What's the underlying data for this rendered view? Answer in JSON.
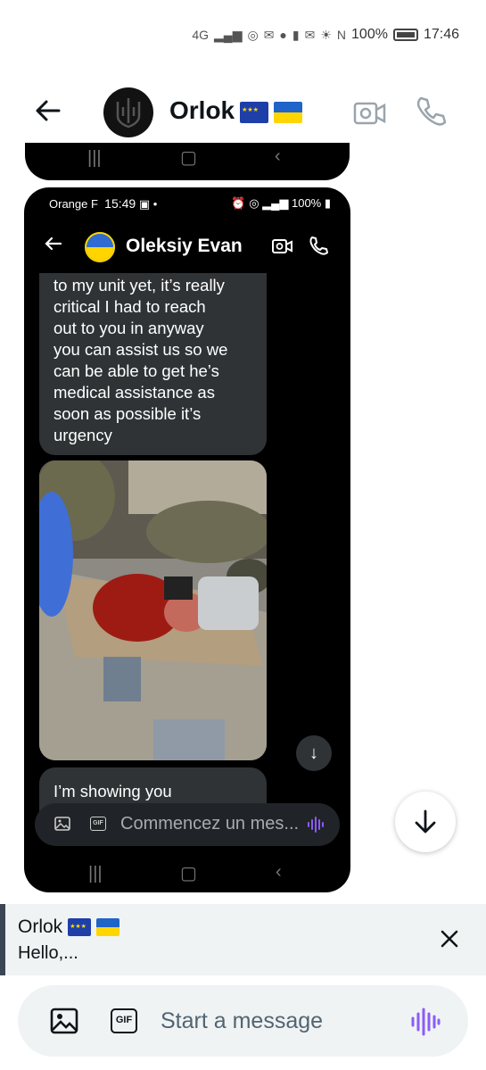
{
  "status_bar": {
    "network": "4G",
    "battery": "100%",
    "time": "17:46"
  },
  "header": {
    "name": "Orlok",
    "accent": "#0f1419"
  },
  "embedded": {
    "status": {
      "carrier": "Orange F",
      "time": "15:49",
      "battery": "100%"
    },
    "contact_name": "Oleksiy Evan",
    "message_1": "to my unit yet, it’s really\ncritical I had to reach\nout to you in anyway\nyou can assist us so we\ncan be able to get he’s\nmedical assistance as\nsoon as possible it’s\nurgency",
    "message_2": "I’m showing you",
    "composer_placeholder": "Commencez un mes..."
  },
  "reply_preview": {
    "name": "Orlok",
    "text": "Hello,..."
  },
  "composer": {
    "placeholder": "Start a message",
    "voice_color": "#8b5cf6"
  }
}
